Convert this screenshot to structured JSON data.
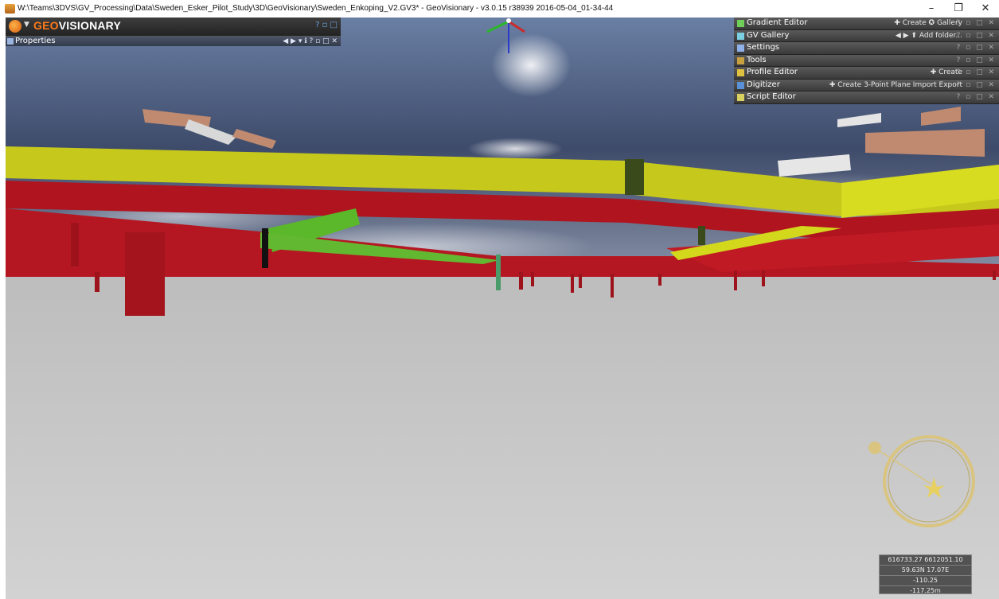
{
  "window": {
    "title": "W:\\Teams\\3DVS\\GV_Processing\\Data\\Sweden_Esker_Pilot_Study\\3D\\GeoVisionary\\Sweden_Enkoping_V2.GV3* - GeoVisionary - v3.0.15 r38939 2016-05-04_01-34-44",
    "minimize": "–",
    "restore": "❐",
    "close": "✕"
  },
  "left_panel": {
    "brand_prefix": "GEO",
    "brand_suffix": "VISIONARY",
    "properties_label": "Properties",
    "header_controls": "? ▫ □",
    "properties_controls": "◀ ▶ ▾ ℹ ? ▫ □ ✕"
  },
  "right_panels": [
    {
      "label": "Gradient Editor",
      "actions": "✚ Create  ✪ Gallery",
      "icon_color": "#6fcf5a"
    },
    {
      "label": "GV Gallery",
      "actions": "◀ ▶  ⬆ Add folder...",
      "icon_color": "#7ad0e0"
    },
    {
      "label": "Settings",
      "actions": "",
      "icon_color": "#8fb0e8"
    },
    {
      "label": "Tools",
      "actions": "",
      "icon_color": "#c7a040"
    },
    {
      "label": "Profile Editor",
      "actions": "✚ Create",
      "icon_color": "#e0c040"
    },
    {
      "label": "Digitizer",
      "actions": "✚ Create  3-Point Plane  Import  Export",
      "icon_color": "#5a90d8"
    },
    {
      "label": "Script Editor",
      "actions": "",
      "icon_color": "#d8d060"
    }
  ],
  "panel_controls": "? ▫ □ ✕",
  "coordinates": {
    "easting_northing": "616733.27 6612051.10",
    "lat_lon": "59.63N 17.07E",
    "value1": "-110.25",
    "depth": "-117.25m"
  },
  "icons": [
    "app-icon",
    "geovisionary-logo-icon",
    "properties-icon",
    "compass-icon",
    "axis-gizmo-icon"
  ],
  "colors": {
    "sky": "#3d4c6e",
    "ground": "#c9c9c9",
    "yellow_layer": "#c9c91a",
    "red_layer": "#b01520",
    "green_layer": "#5cb82a",
    "accent_orange": "#ff7a1a"
  }
}
